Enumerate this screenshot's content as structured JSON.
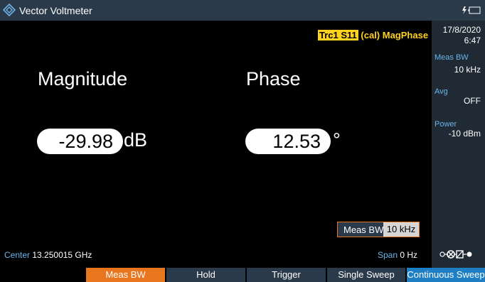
{
  "window": {
    "title": "Vector Voltmeter"
  },
  "icons": {
    "logo": "rs-diamond-logo-icon",
    "battery": "battery-charging-icon",
    "connector": "connector-status-icon"
  },
  "trace": {
    "name": "Trc1 S11",
    "suffix": "(cal) MagPhase"
  },
  "readings": {
    "magnitude": {
      "label": "Magnitude",
      "value": "-29.98",
      "unit": "dB"
    },
    "phase": {
      "label": "Phase",
      "value": "12.53",
      "unit": "°"
    }
  },
  "meas_bw_box": {
    "label": "Meas BW",
    "value": "10 kHz"
  },
  "side_panel": {
    "date": "17/8/2020",
    "time": "6:47",
    "meas_bw_label": "Meas BW",
    "meas_bw_value": "10 kHz",
    "avg_label": "Avg",
    "avg_value": "OFF",
    "power_label": "Power",
    "power_value": "-10 dBm"
  },
  "status": {
    "center_label": "Center",
    "center_value": "13.250015 GHz",
    "span_label": "Span",
    "span_value": "0 Hz"
  },
  "softkeys": [
    "Meas BW",
    "Hold",
    "Trigger",
    "Single Sweep",
    "Continuous Sweep"
  ],
  "colors": {
    "accent": "#e8761e",
    "blue": "#1e7fc4",
    "trace": "#ffd21e",
    "panel": "#1f2a34"
  }
}
